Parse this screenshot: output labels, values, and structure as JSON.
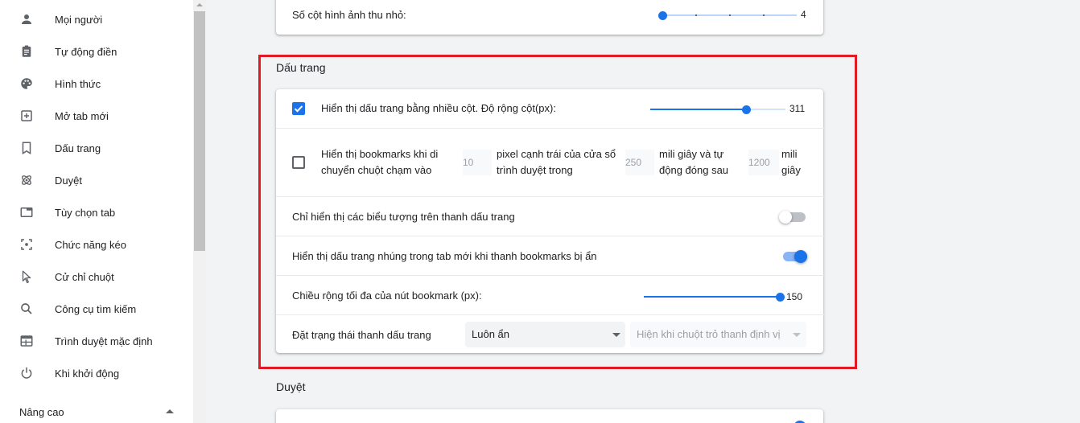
{
  "sidebar": {
    "items": [
      {
        "label": "Mọi người",
        "icon": "person-icon"
      },
      {
        "label": "Tự động điền",
        "icon": "clipboard-icon"
      },
      {
        "label": "Hình thức",
        "icon": "palette-icon"
      },
      {
        "label": "Mở tab mới",
        "icon": "add-box-icon"
      },
      {
        "label": "Dấu trang",
        "icon": "bookmark-icon"
      },
      {
        "label": "Duyệt",
        "icon": "atom-icon"
      },
      {
        "label": "Tùy chọn tab",
        "icon": "tab-icon"
      },
      {
        "label": "Chức năng kéo",
        "icon": "drag-icon"
      },
      {
        "label": "Cử chỉ chuột",
        "icon": "cursor-icon"
      },
      {
        "label": "Công cụ tìm kiếm",
        "icon": "search-icon"
      },
      {
        "label": "Trình duyệt mặc định",
        "icon": "browser-icon"
      },
      {
        "label": "Khi khởi động",
        "icon": "power-icon"
      }
    ],
    "advanced_label": "Nâng cao"
  },
  "top_card": {
    "label": "Số cột hình ảnh thu nhỏ:",
    "value": "4"
  },
  "bookmarks": {
    "title": "Dấu trang",
    "multi_column": {
      "label": "Hiển thị dấu trang bằng nhiều cột. Độ rộng cột(px):",
      "checked": true,
      "value": "311",
      "fraction": 0.72
    },
    "hover": {
      "checked": false,
      "text1": "Hiển thị bookmarks khi di chuyển chuột chạm vào",
      "input1": "10",
      "text2": "pixel cạnh trái của cửa sổ trình duyệt trong",
      "input2": "250",
      "text3": "mili giây và tự động đóng sau",
      "input3": "1200",
      "text4": "mili giây"
    },
    "icons_only": {
      "label": "Chỉ hiển thị các biểu tượng trên thanh dấu trang",
      "on": false
    },
    "embedded": {
      "label": "Hiển thị dấu trang nhúng trong tab mới khi thanh bookmarks bị ẩn",
      "on": true
    },
    "max_width": {
      "label": "Chiều rộng tối đa của nút bookmark (px):",
      "value": "150",
      "fraction": 1.0
    },
    "bar_state": {
      "label": "Đặt trạng thái thanh dấu trang",
      "select1": "Luôn ẩn",
      "select2": "Hiện khi chuột trỏ thanh định vị"
    }
  },
  "browse_section": {
    "title": "Duyệt"
  },
  "colors": {
    "accent": "#1a73e8",
    "highlight": "#e01b24"
  }
}
